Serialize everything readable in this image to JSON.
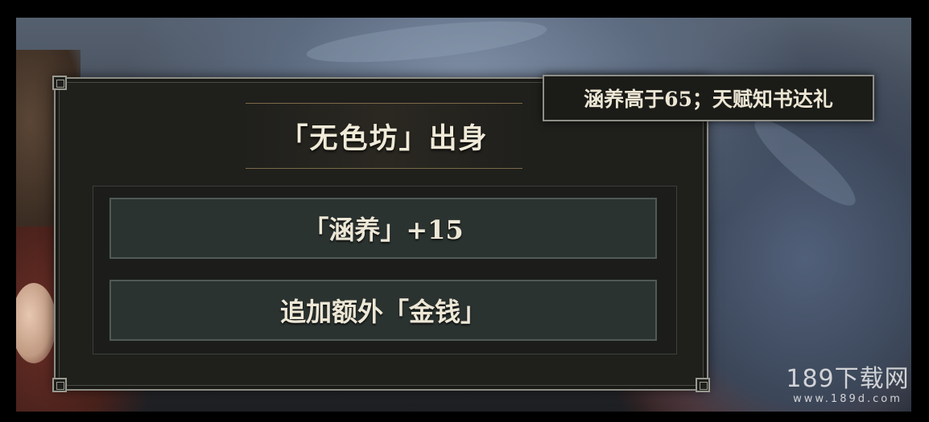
{
  "panel": {
    "title": "「无色坊」出身",
    "options": [
      {
        "label": "「涵养」+15"
      },
      {
        "label": "追加额外「金钱」"
      }
    ]
  },
  "tooltip": {
    "text": "涵养高于65；天赋知书达礼"
  },
  "watermark": {
    "main": "189下载网",
    "sub": "www.189d.com"
  }
}
